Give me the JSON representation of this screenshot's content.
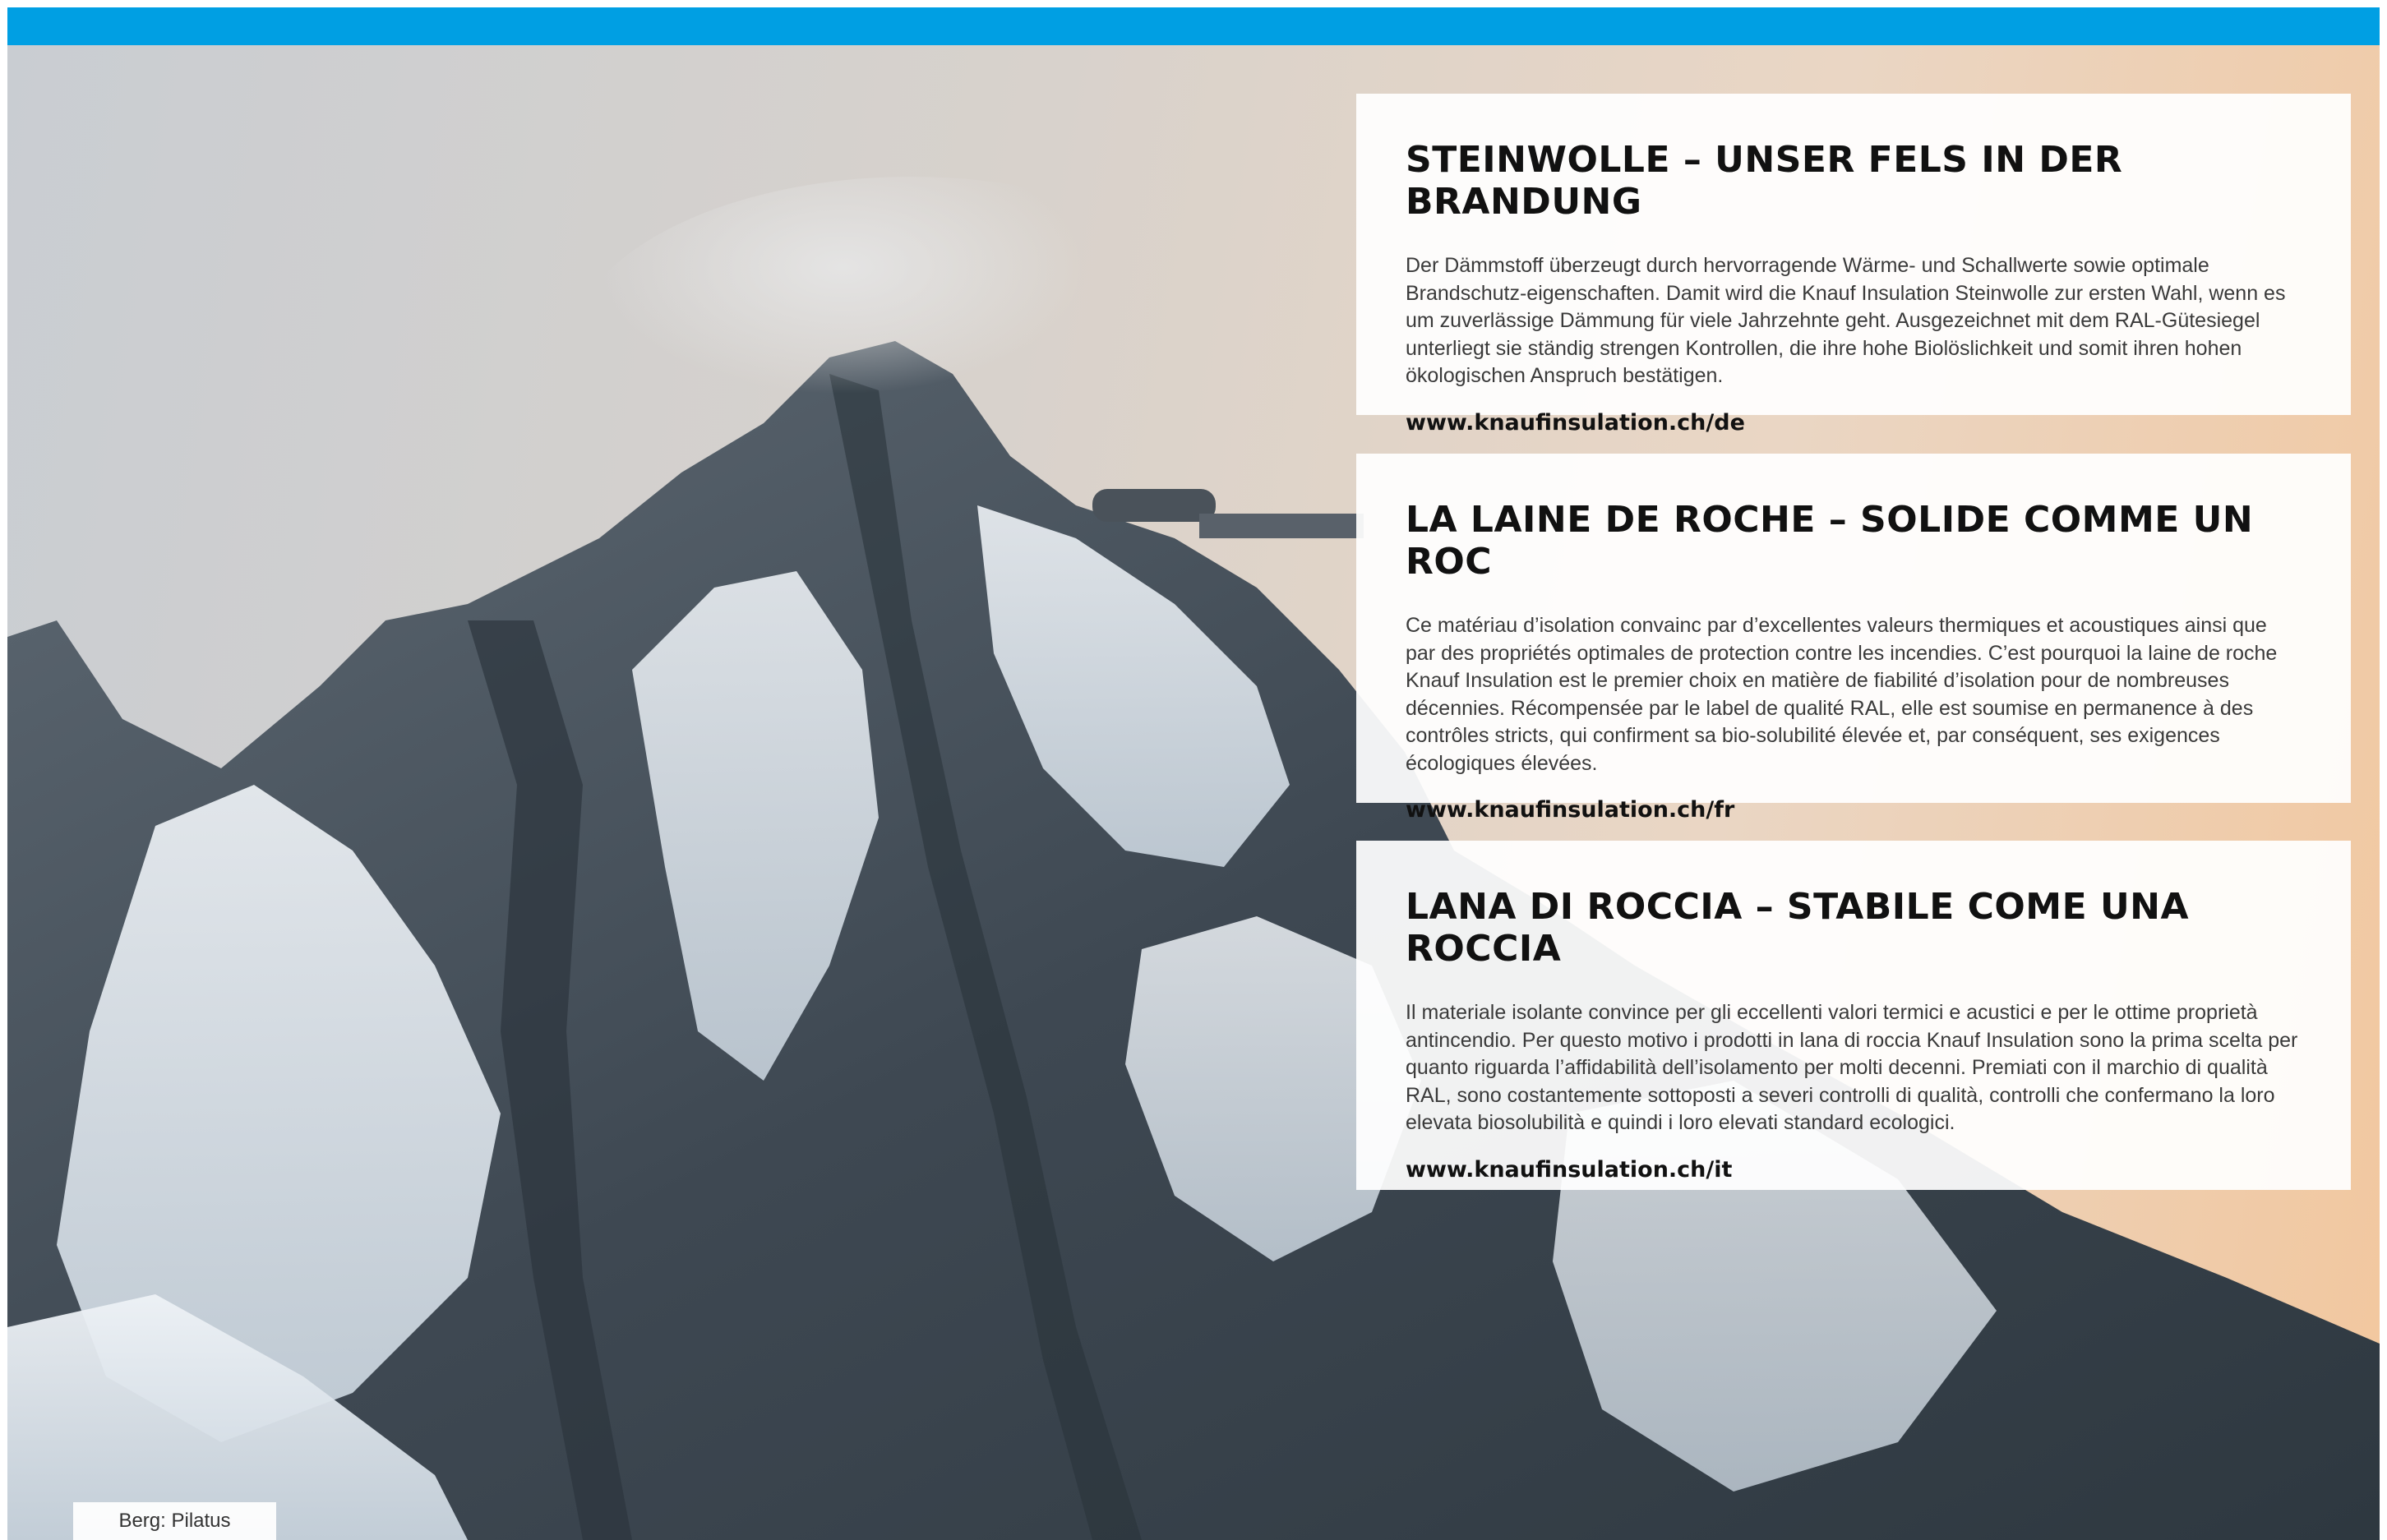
{
  "brand": {
    "bar_color": "#009fe3"
  },
  "photo": {
    "caption": "Berg: Pilatus"
  },
  "sections": [
    {
      "title": "STEINWOLLE – UNSER FELS IN DER BRANDUNG",
      "body": "Der Dämmstoff überzeugt durch hervorragende Wärme- und Schallwerte sowie optimale Brandschutz-eigenschaften. Damit wird die Knauf Insulation Steinwolle zur ersten Wahl, wenn es um zuverlässige Dämmung für viele Jahrzehnte geht. Ausgezeichnet mit dem RAL-Gütesiegel unterliegt sie ständig strengen Kontrollen, die ihre hohe Biolöslichkeit und somit ihren hohen ökologischen Anspruch bestätigen.",
      "link": "www.knaufinsulation.ch/de"
    },
    {
      "title": "LA LAINE DE ROCHE – SOLIDE COMME UN ROC",
      "body": "Ce matériau d’isolation convainc par d’excellentes valeurs thermiques et acoustiques ainsi que par des propriétés optimales de protection contre les incendies. C’est pourquoi la laine de roche Knauf Insulation est le premier choix en matière de fiabilité d’isolation pour de nombreuses décennies. Récompensée par le label de qualité RAL, elle est soumise en permanence à des contrôles stricts, qui confirment sa bio-solubilité élevée et, par conséquent, ses exigences écologiques élevées.",
      "link": "www.knaufinsulation.ch/fr"
    },
    {
      "title": "LANA DI ROCCIA – STABILE COME UNA ROCCIA",
      "body": "Il materiale isolante convince per gli eccellenti valori termici e acustici e per le ottime proprietà antincendio. Per questo motivo i prodotti in lana di roccia Knauf Insulation sono la prima scelta per quanto riguarda l’affidabilità dell’isolamento per molti decenni. Premiati con il marchio di qualità RAL, sono costantemente sottoposti a severi controlli di qualità, controlli che confermano la loro elevata biosolubilità e quindi i loro elevati standard ecologici.",
      "link": "www.knaufinsulation.ch/it"
    }
  ]
}
